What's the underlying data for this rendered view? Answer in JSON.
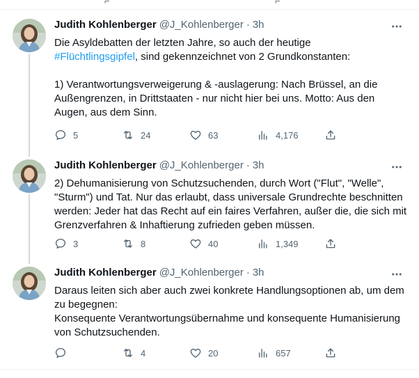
{
  "thread": [
    {
      "author_name": "Judith Kohlenberger",
      "handle": "@J_Kohlenberger",
      "separator": "·",
      "time": "3h",
      "text_line1": "Die Asyldebatten der letzten Jahre, so auch der heutige",
      "hashtag": "#Flüchtlingsgipfel",
      "text_line2_rest": ", sind gekennzeichnet von 2 Grundkonstanten:",
      "text_para2": "1) Verantwortungsverweigerung & -auslagerung: Nach Brüssel, an die Außengrenzen, in Drittstaaten - nur nicht hier bei uns. Motto: Aus den Augen, aus dem Sinn.",
      "replies": "5",
      "retweets": "24",
      "likes": "63",
      "views": "4,176"
    },
    {
      "author_name": "Judith Kohlenberger",
      "handle": "@J_Kohlenberger",
      "separator": "·",
      "time": "3h",
      "text": "2) Dehumanisierung von Schutzsuchenden, durch Wort (\"Flut\", \"Welle\", \"Sturm\") und Tat. Nur das erlaubt, dass universale Grundrechte beschnitten werden: Jeder hat das Recht auf ein faires Verfahren, außer die, die sich mit Grenzverfahren & Inhaftierung zufrieden geben müssen.",
      "replies": "3",
      "retweets": "8",
      "likes": "40",
      "views": "1,349"
    },
    {
      "author_name": "Judith Kohlenberger",
      "handle": "@J_Kohlenberger",
      "separator": "·",
      "time": "3h",
      "text_line1": "Daraus leiten sich aber auch zwei konkrete Handlungsoptionen ab, um dem zu begegnen:",
      "text_line2": "Konsequente Verantwortungsübernahme und konsequente Humanisierung von Schutzsuchenden.",
      "replies": "",
      "retweets": "4",
      "likes": "20",
      "views": "657"
    }
  ],
  "colors": {
    "text": "#0f1419",
    "secondary": "#536471",
    "link": "#1d9bf0",
    "border": "#eff3f4",
    "thread_line": "#cfd9de"
  },
  "icons": [
    "more-icon",
    "reply-icon",
    "retweet-icon",
    "like-icon",
    "views-icon",
    "share-icon"
  ]
}
